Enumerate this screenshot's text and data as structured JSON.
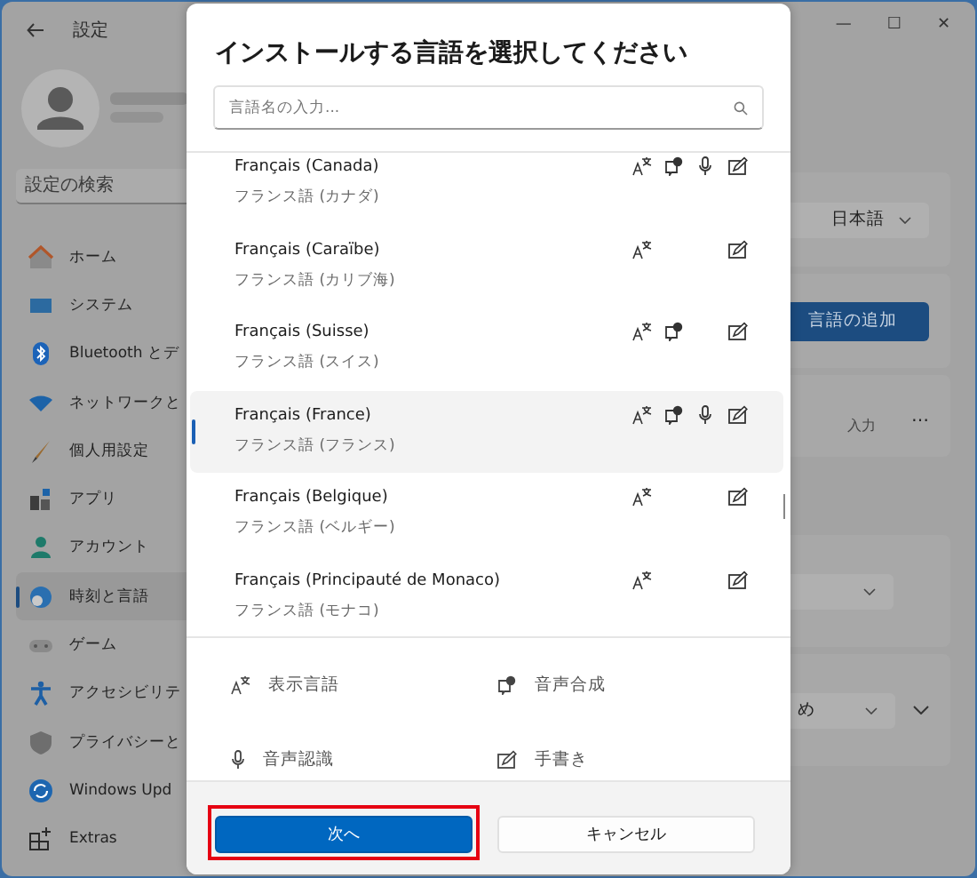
{
  "window": {
    "title": "設定",
    "controls": [
      "—",
      "☐",
      "✕"
    ]
  },
  "sidebar": {
    "search_placeholder": "設定の検索",
    "items": [
      {
        "label": "ホーム",
        "selected": false
      },
      {
        "label": "システム",
        "selected": false
      },
      {
        "label": "Bluetooth とデ",
        "selected": false
      },
      {
        "label": "ネットワークと",
        "selected": false
      },
      {
        "label": "個人用設定",
        "selected": false
      },
      {
        "label": "アプリ",
        "selected": false
      },
      {
        "label": "アカウント",
        "selected": false
      },
      {
        "label": "時刻と言語",
        "selected": true
      },
      {
        "label": "ゲーム",
        "selected": false
      },
      {
        "label": "アクセシビリテ",
        "selected": false
      },
      {
        "label": "プライバシーと",
        "selected": false
      },
      {
        "label": "Windows Upd",
        "selected": false
      },
      {
        "label": "Extras",
        "selected": false
      }
    ]
  },
  "main": {
    "cards": [
      {
        "kind": "dropdown",
        "value": "日本語"
      },
      {
        "kind": "button",
        "label": "言語の追加"
      },
      {
        "kind": "more",
        "text": "入力",
        "more": "…"
      },
      {
        "kind": "dropdown"
      },
      {
        "kind": "dropdown_expand",
        "value": "め"
      }
    ]
  },
  "dialog": {
    "title": "インストールする言語を選択してください",
    "search": {
      "placeholder": "言語名の入力..."
    },
    "languages": [
      {
        "name": "Français (Canada)",
        "native": "フランス語 (カナダ)",
        "selected": false,
        "display": true,
        "tts": true,
        "speech": true,
        "handwriting": true
      },
      {
        "name": "Français (Caraïbe)",
        "native": "フランス語 (カリブ海)",
        "selected": false,
        "display": true,
        "tts": false,
        "speech": false,
        "handwriting": true
      },
      {
        "name": "Français (Suisse)",
        "native": "フランス語 (スイス)",
        "selected": false,
        "display": true,
        "tts": true,
        "speech": false,
        "handwriting": true
      },
      {
        "name": "Français (France)",
        "native": "フランス語 (フランス)",
        "selected": true,
        "display": true,
        "tts": true,
        "speech": true,
        "handwriting": true
      },
      {
        "name": "Français (Belgique)",
        "native": "フランス語 (ベルギー)",
        "selected": false,
        "display": true,
        "tts": false,
        "speech": false,
        "handwriting": true
      },
      {
        "name": "Français (Principauté de Monaco)",
        "native": "フランス語 (モナコ)",
        "selected": false,
        "display": true,
        "tts": false,
        "speech": false,
        "handwriting": true
      }
    ],
    "legend": [
      {
        "kind": "display",
        "label": "表示言語"
      },
      {
        "kind": "tts",
        "label": "音声合成"
      },
      {
        "kind": "speech",
        "label": "音声認識"
      },
      {
        "kind": "handwriting",
        "label": "手書き"
      }
    ],
    "buttons": [
      {
        "label": "次へ",
        "kind": "primary",
        "highlighted": true
      },
      {
        "label": "キャンセル",
        "kind": "secondary",
        "highlighted": false
      }
    ]
  }
}
